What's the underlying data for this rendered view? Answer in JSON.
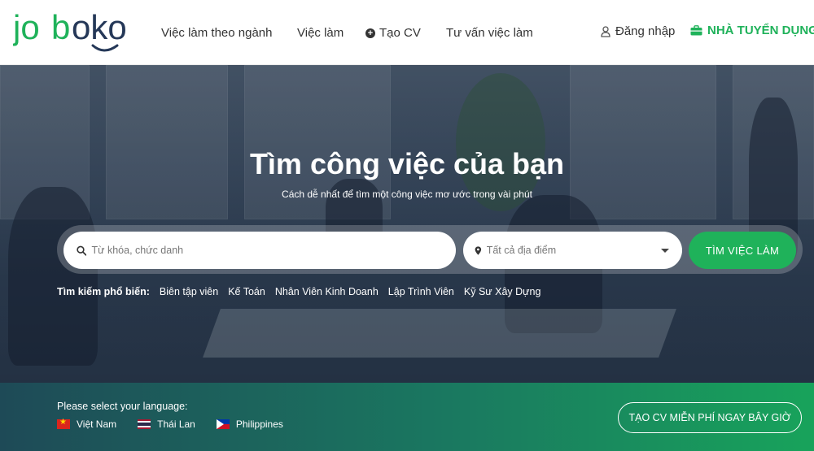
{
  "brand": {
    "logo_text": "joboko",
    "accent_color": "#1fb25a",
    "dark_color": "#253858"
  },
  "nav": {
    "items": [
      {
        "label": "Việc làm theo ngành"
      },
      {
        "label": "Việc làm"
      },
      {
        "label": "Tạo CV",
        "icon": "plus-circle-icon"
      },
      {
        "label": "Tư vấn việc làm"
      }
    ],
    "login_label": "Đăng nhập",
    "employer_label": "NHÀ TUYỂN DỤNG"
  },
  "hero": {
    "title": "Tìm công việc của bạn",
    "subtitle": "Cách dễ nhất để tìm một công việc mơ ước trong vài phút"
  },
  "search": {
    "keyword_placeholder": "Từ khóa, chức danh",
    "location_placeholder": "Tất cả địa điểm",
    "button_label": "TÌM VIỆC LÀM"
  },
  "popular": {
    "label": "Tìm kiếm phổ biến:",
    "tags": [
      "Biên tập viên",
      "Kế Toán",
      "Nhân Viên Kinh Doanh",
      "Lập Trình Viên",
      "Kỹ Sư Xây Dựng"
    ]
  },
  "language": {
    "title": "Please select your language:",
    "options": [
      {
        "label": "Việt Nam",
        "flag": "vietnam-flag"
      },
      {
        "label": "Thái Lan",
        "flag": "thailand-flag"
      },
      {
        "label": "Philippines",
        "flag": "philippines-flag"
      }
    ]
  },
  "cta": {
    "label": "TẠO CV MIỄN PHÍ NGAY BÂY GIỜ"
  }
}
